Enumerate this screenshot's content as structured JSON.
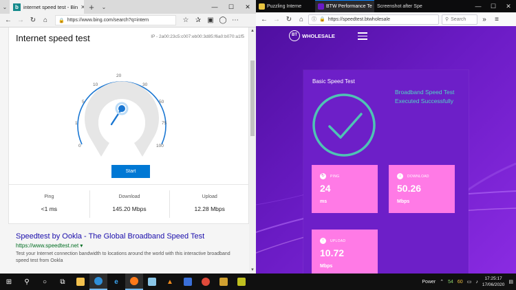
{
  "edge": {
    "tab_title": "internet speed test - Bin",
    "url": "https://www.bing.com/search?q=intern",
    "card": {
      "title": "Internet speed test",
      "ip": "IP - 2a00:23c5:c007:eb00:3d85:f6a0:b070:a1f5",
      "gauge_labels": [
        "0",
        "1",
        "5",
        "10",
        "20",
        "30",
        "50",
        "75",
        "100"
      ],
      "start_label": "Start",
      "stats": [
        {
          "label": "Ping",
          "value": "<1 ms"
        },
        {
          "label": "Download",
          "value": "145.20 Mbps"
        },
        {
          "label": "Upload",
          "value": "12.28 Mbps"
        }
      ]
    },
    "result": {
      "title": "Speedtest by Ookla - The Global Broadband Speed Test",
      "url": "https://www.speedtest.net",
      "description": "Test your Internet connection bandwidth to locations around the world with this interactive broadband speed test from Ookla"
    }
  },
  "firefox": {
    "tabs": [
      {
        "label": "Puzzling Interne",
        "color": "#e8c440",
        "active": false
      },
      {
        "label": "BTW Performance Te",
        "color": "#6a1bc4",
        "active": true
      },
      {
        "label": "Screenshot after Spe",
        "color": "#d05858",
        "active": false
      }
    ],
    "url": "https://speedtest.btwholesale",
    "search_placeholder": "Search",
    "site": {
      "logo_text": "WHOLESALE",
      "logo_mark": "BT",
      "panel_title": "Basic Speed Test",
      "status_message": "Broadband Speed Test Executed Successfully",
      "tiles": [
        {
          "key": "ping",
          "label": "PING",
          "value": "24",
          "unit": "ms"
        },
        {
          "key": "download",
          "label": "DOWNLOAD",
          "value": "50.26",
          "unit": "Mbps"
        },
        {
          "key": "upload",
          "label": "UPLOAD",
          "value": "10.72",
          "unit": "Mbps"
        }
      ]
    }
  },
  "taskbar": {
    "tray_label": "Power",
    "tray_n1": "54",
    "tray_n2": "60",
    "time": "17:25:17",
    "date": "17/06/2020"
  }
}
